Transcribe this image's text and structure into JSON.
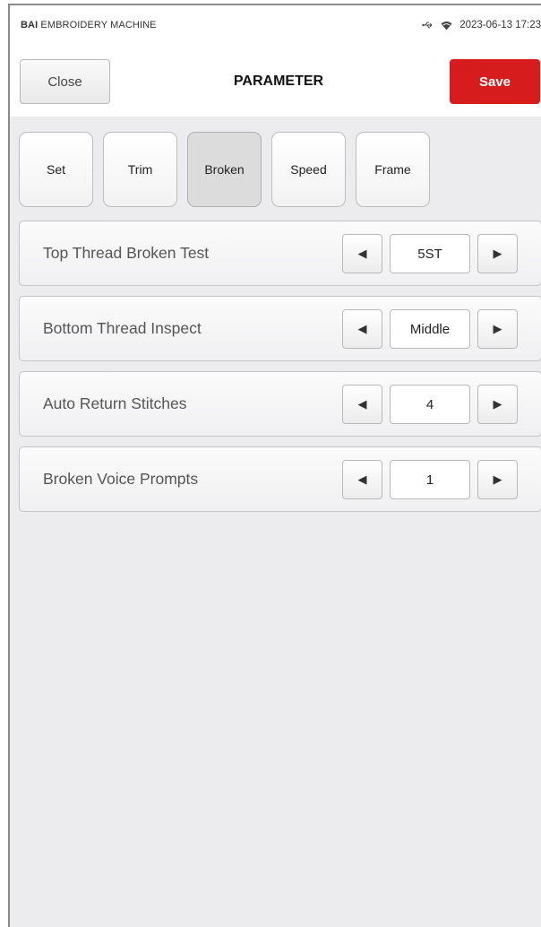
{
  "status_bar": {
    "brand_bold": "BAI",
    "brand_rest": " EMBROIDERY MACHINE",
    "usb_icon": "usb-icon",
    "wifi_icon": "wifi-icon",
    "datetime": "2023-06-13 17:23"
  },
  "header": {
    "close_label": "Close",
    "title": "PARAMETER",
    "save_label": "Save",
    "save_color": "#d61c1c"
  },
  "tabs": [
    {
      "label": "Set",
      "active": false
    },
    {
      "label": "Trim",
      "active": false
    },
    {
      "label": "Broken",
      "active": true
    },
    {
      "label": "Speed",
      "active": false
    },
    {
      "label": "Frame",
      "active": false
    }
  ],
  "params": [
    {
      "label": "Top Thread Broken Test",
      "value": "5ST"
    },
    {
      "label": "Bottom Thread Inspect",
      "value": "Middle"
    },
    {
      "label": "Auto Return Stitches",
      "value": "4"
    },
    {
      "label": "Broken Voice Prompts",
      "value": "1"
    }
  ]
}
